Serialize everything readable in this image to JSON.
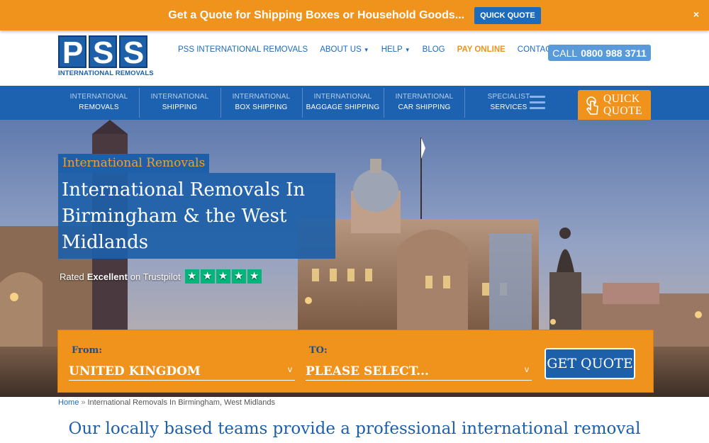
{
  "promo": {
    "text": "Get a Quote for Shipping Boxes or Household Goods...",
    "button": "QUICK QUOTE",
    "close": "×"
  },
  "logo": {
    "letters": [
      "P",
      "S",
      "S"
    ],
    "subtitle": "INTERNATIONAL REMOVALS"
  },
  "topnav": [
    {
      "label": "PSS INTERNATIONAL REMOVALS"
    },
    {
      "label": "ABOUT US",
      "dropdown": true
    },
    {
      "label": "HELP",
      "dropdown": true
    },
    {
      "label": "BLOG"
    },
    {
      "label": "PAY ONLINE"
    },
    {
      "label": "CONTACT US"
    }
  ],
  "call": {
    "prefix": "CALL",
    "number": "0800 988 3711"
  },
  "mainnav": [
    {
      "line1": "INTERNATIONAL",
      "line2": "REMOVALS"
    },
    {
      "line1": "INTERNATIONAL",
      "line2": "SHIPPING"
    },
    {
      "line1": "INTERNATIONAL",
      "line2": "BOX SHIPPING"
    },
    {
      "line1": "INTERNATIONAL",
      "line2": "BAGGAGE SHIPPING"
    },
    {
      "line1": "INTERNATIONAL",
      "line2": "CAR SHIPPING"
    },
    {
      "line1": "SPECIALIST",
      "line2": "SERVICES"
    }
  ],
  "quick_quote": {
    "line1": "QUICK",
    "line2": "QUOTE",
    "icon": "hand-pointer-icon"
  },
  "hero": {
    "kicker": "International Removals",
    "headline": "International Removals In Birmingham & the West Midlands",
    "rating": {
      "prefix": "Rated",
      "word": "Excellent",
      "suffix": "on Trustpilot",
      "stars": 5
    }
  },
  "quote_form": {
    "from_label": "From:",
    "from_value": "UNITED KINGDOM",
    "to_label": "TO:",
    "to_value": "PLEASE SELECT...",
    "button": "GET QUOTE"
  },
  "breadcrumb": {
    "home": "Home",
    "separator": "»",
    "current": "International Removals In Birmingham, West Midlands"
  },
  "intro": "Our locally based teams provide a professional international removal",
  "colors": {
    "orange": "#f0931d",
    "blue": "#1d62b0",
    "trustpilot": "#00b67a"
  }
}
